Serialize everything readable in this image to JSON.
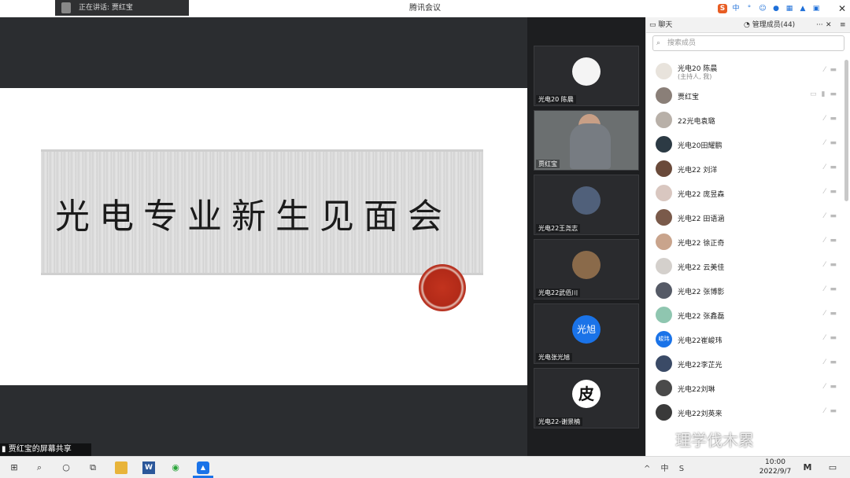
{
  "titlebar": {
    "speaking_text": "正在讲话: 贾红宝",
    "app_title": "腾讯会议",
    "ime_icon": "S",
    "ime_mode": "中",
    "close_glyph": "✕"
  },
  "shared_screen": {
    "slide_title": "光电专业新生见面会",
    "sharer_label": "贾红宝的屏幕共享"
  },
  "video_tiles": [
    {
      "name": "光电20 陈晨"
    },
    {
      "name": "贾红宝"
    },
    {
      "name": "光电22王尧志"
    },
    {
      "name": "光电22武佰川"
    },
    {
      "name": "光电张光旭",
      "avatar_text": "光旭"
    },
    {
      "name": "光电22-谢景楠",
      "avatar_text": "皮"
    }
  ],
  "panel": {
    "tab_chat": "聊天",
    "tab_members": "管理成员(44)",
    "more_glyph": "···",
    "close_glyph": "✕",
    "search_placeholder": "搜索成员"
  },
  "members": [
    {
      "name": "光电20 陈晨",
      "sub": "(主持人, 我)",
      "color": "#e8e3dc"
    },
    {
      "name": "贾红宝",
      "color": "#8a7f78"
    },
    {
      "name": "22光电袁璐",
      "color": "#b8b0a8"
    },
    {
      "name": "光电20田耀鹏",
      "color": "#2c3a44"
    },
    {
      "name": "光电22 刘洋",
      "color": "#6a4a3a"
    },
    {
      "name": "光电22 庞昱森",
      "color": "#d9c7c0"
    },
    {
      "name": "光电22 田语涵",
      "color": "#7a5a4a"
    },
    {
      "name": "光电22 徐正奇",
      "color": "#c9a48c"
    },
    {
      "name": "光电22 云美佳",
      "color": "#d4d0cc"
    },
    {
      "name": "光电22 张博影",
      "color": "#555a66"
    },
    {
      "name": "光电22 张鑫磊",
      "color": "#8fc6b0"
    },
    {
      "name": "光电22崔峻玮",
      "avatar_text": "峻玮",
      "color": "#1a73e8"
    },
    {
      "name": "光电22李芷光",
      "color": "#3a4a66"
    },
    {
      "name": "光电22刘琳",
      "color": "#4a4a4a"
    },
    {
      "name": "光电22刘英来",
      "color": "#3a3a3a"
    }
  ],
  "watermark": "理学伐木累",
  "taskbar": {
    "time": "10:00",
    "date": "2022/9/7",
    "tray_text": "^ 中 S"
  }
}
